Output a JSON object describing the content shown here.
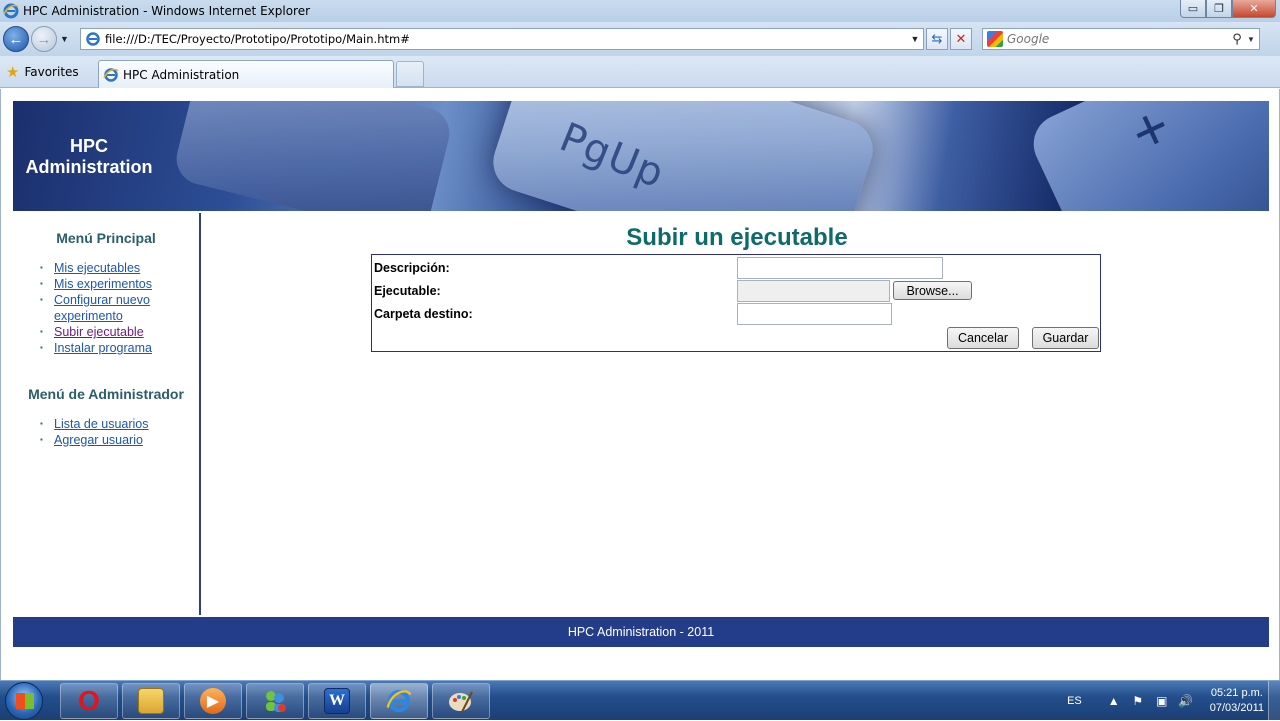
{
  "window": {
    "title": "HPC Administration - Windows Internet Explorer",
    "minimize": "▭",
    "restore": "❐",
    "close": "✕"
  },
  "browser": {
    "url": "file:///D:/TEC/Proyecto/Prototipo/Prototipo/Main.htm#",
    "search_placeholder": "Google",
    "favorites_label": "Favorites",
    "tab_title": "HPC Administration"
  },
  "page": {
    "banner_title": "HPC Administration",
    "banner_key_text": "PgUp",
    "main_menu": {
      "title": "Menú Principal",
      "items": [
        {
          "label": "Mis ejecutables"
        },
        {
          "label": "Mis experimentos"
        },
        {
          "label": "Configurar nuevo experimento"
        },
        {
          "label": "Subir ejecutable"
        },
        {
          "label": "Instalar programa"
        }
      ]
    },
    "admin_menu": {
      "title": "Menú de Administrador",
      "items": [
        {
          "label": "Lista de usuarios"
        },
        {
          "label": "Agregar usuario"
        }
      ]
    },
    "content": {
      "title": "Subir un ejecutable",
      "fields": {
        "descripcion_label": "Descripción:",
        "descripcion_value": "",
        "ejecutable_label": "Ejecutable:",
        "ejecutable_value": "",
        "browse_label": "Browse...",
        "carpeta_label": "Carpeta destino:",
        "carpeta_value": ""
      },
      "cancel_label": "Cancelar",
      "save_label": "Guardar"
    },
    "footer": "HPC Administration - 2011"
  },
  "taskbar": {
    "language": "ES",
    "time": "05:21 p.m.",
    "date": "07/03/2011",
    "apps": [
      "opera-icon",
      "explorer-icon",
      "media-player-icon",
      "messenger-icon",
      "word-icon",
      "internet-explorer-icon",
      "paint-icon"
    ]
  }
}
